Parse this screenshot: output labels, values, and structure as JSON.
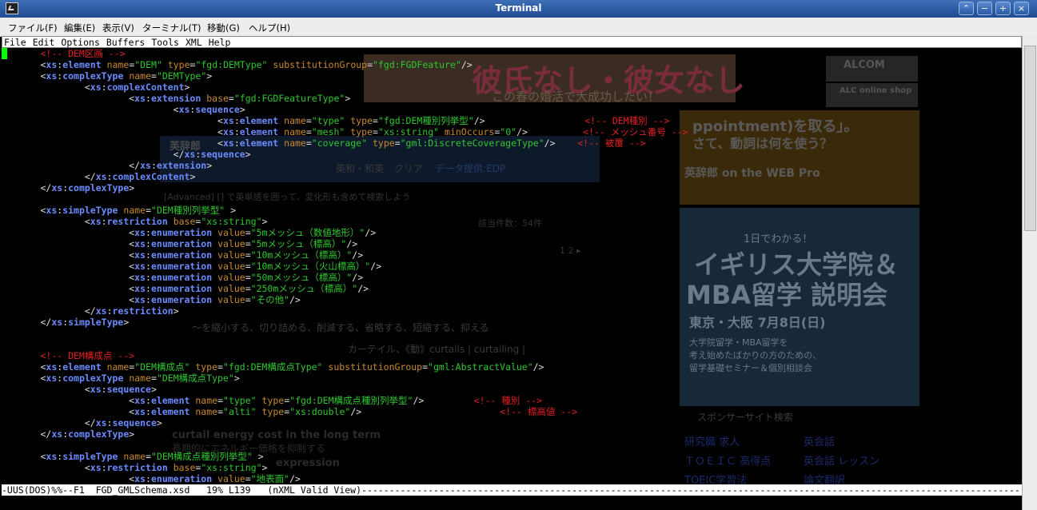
{
  "window": {
    "title": "Terminal",
    "buttons": [
      "⌃",
      "−",
      "+",
      "×"
    ]
  },
  "terminal_menu": [
    "ファイル(F)",
    "編集(E)",
    "表示(V)",
    "ターミナル(T)",
    "移動(G)",
    "ヘルプ(H)"
  ],
  "emacs_menu": [
    "File",
    "Edit",
    "Options",
    "Buffers",
    "Tools",
    "XML",
    "Help"
  ],
  "editor_lines": [
    [
      [
        "cmt",
        "<!-- DEM区画 -->"
      ]
    ],
    [
      [
        "p",
        "<"
      ],
      [
        "ns",
        "xs"
      ],
      [
        "p",
        ":"
      ],
      [
        "tag",
        "element"
      ],
      [
        "p",
        " "
      ],
      [
        "attr",
        "name"
      ],
      [
        "p",
        "="
      ],
      [
        "val",
        "\"DEM\""
      ],
      [
        "p",
        " "
      ],
      [
        "attr",
        "type"
      ],
      [
        "p",
        "="
      ],
      [
        "val",
        "\"fgd:DEMType\""
      ],
      [
        "p",
        " "
      ],
      [
        "attr",
        "substitutionGroup"
      ],
      [
        "p",
        "="
      ],
      [
        "val",
        "\"fgd:FGDFeature\""
      ],
      [
        "p",
        "/>"
      ]
    ],
    [
      [
        "p",
        "<"
      ],
      [
        "ns",
        "xs"
      ],
      [
        "p",
        ":"
      ],
      [
        "tag",
        "complexType"
      ],
      [
        "p",
        " "
      ],
      [
        "attr",
        "name"
      ],
      [
        "p",
        "="
      ],
      [
        "val",
        "\"DEMType\""
      ],
      [
        "p",
        ">"
      ]
    ],
    [
      [
        "p",
        "        <"
      ],
      [
        "ns",
        "xs"
      ],
      [
        "p",
        ":"
      ],
      [
        "tag",
        "complexContent"
      ],
      [
        "p",
        ">"
      ]
    ],
    [
      [
        "p",
        "                <"
      ],
      [
        "ns",
        "xs"
      ],
      [
        "p",
        ":"
      ],
      [
        "tag",
        "extension"
      ],
      [
        "p",
        " "
      ],
      [
        "attr",
        "base"
      ],
      [
        "p",
        "="
      ],
      [
        "val",
        "\"fgd:FGDFeatureType\""
      ],
      [
        "p",
        ">"
      ]
    ],
    [
      [
        "p",
        "                        <"
      ],
      [
        "ns",
        "xs"
      ],
      [
        "p",
        ":"
      ],
      [
        "tag",
        "sequence"
      ],
      [
        "p",
        ">"
      ]
    ],
    [
      [
        "p",
        "                                <"
      ],
      [
        "ns",
        "xs"
      ],
      [
        "p",
        ":"
      ],
      [
        "tag",
        "element"
      ],
      [
        "p",
        " "
      ],
      [
        "attr",
        "name"
      ],
      [
        "p",
        "="
      ],
      [
        "val",
        "\"type\""
      ],
      [
        "p",
        " "
      ],
      [
        "attr",
        "type"
      ],
      [
        "p",
        "="
      ],
      [
        "val",
        "\"fgd:DEM種別列挙型\""
      ],
      [
        "p",
        "/>                  "
      ],
      [
        "cmt",
        "<!-- DEM種別 -->"
      ]
    ],
    [
      [
        "p",
        "                                <"
      ],
      [
        "ns",
        "xs"
      ],
      [
        "p",
        ":"
      ],
      [
        "tag",
        "element"
      ],
      [
        "p",
        " "
      ],
      [
        "attr",
        "name"
      ],
      [
        "p",
        "="
      ],
      [
        "val",
        "\"mesh\""
      ],
      [
        "p",
        " "
      ],
      [
        "attr",
        "type"
      ],
      [
        "p",
        "="
      ],
      [
        "val",
        "\"xs:string\""
      ],
      [
        "p",
        " "
      ],
      [
        "attr",
        "minOccurs"
      ],
      [
        "p",
        "="
      ],
      [
        "val",
        "\"0\""
      ],
      [
        "p",
        "/>          "
      ],
      [
        "cmt",
        "<!-- メッシュ番号 -->"
      ]
    ],
    [
      [
        "p",
        "                                <"
      ],
      [
        "ns",
        "xs"
      ],
      [
        "p",
        ":"
      ],
      [
        "tag",
        "element"
      ],
      [
        "p",
        " "
      ],
      [
        "attr",
        "name"
      ],
      [
        "p",
        "="
      ],
      [
        "val",
        "\"coverage\""
      ],
      [
        "p",
        " "
      ],
      [
        "attr",
        "type"
      ],
      [
        "p",
        "="
      ],
      [
        "val",
        "\"gml:DiscreteCoverageType\""
      ],
      [
        "p",
        "/>    "
      ],
      [
        "cmt",
        "<!-- 被覆 -->"
      ]
    ],
    [
      [
        "p",
        "                        </"
      ],
      [
        "ns",
        "xs"
      ],
      [
        "p",
        ":"
      ],
      [
        "tag",
        "sequence"
      ],
      [
        "p",
        ">"
      ]
    ],
    [
      [
        "p",
        "                </"
      ],
      [
        "ns",
        "xs"
      ],
      [
        "p",
        ":"
      ],
      [
        "tag",
        "extension"
      ],
      [
        "p",
        ">"
      ]
    ],
    [
      [
        "p",
        "        </"
      ],
      [
        "ns",
        "xs"
      ],
      [
        "p",
        ":"
      ],
      [
        "tag",
        "complexContent"
      ],
      [
        "p",
        ">"
      ]
    ],
    [
      [
        "p",
        "</"
      ],
      [
        "ns",
        "xs"
      ],
      [
        "p",
        ":"
      ],
      [
        "tag",
        "complexType"
      ],
      [
        "p",
        ">"
      ]
    ],
    [
      [
        "p",
        ""
      ]
    ],
    [
      [
        "p",
        "<"
      ],
      [
        "ns",
        "xs"
      ],
      [
        "p",
        ":"
      ],
      [
        "tag",
        "simpleType"
      ],
      [
        "p",
        " "
      ],
      [
        "attr",
        "name"
      ],
      [
        "p",
        "="
      ],
      [
        "val",
        "\"DEM種別列挙型\""
      ],
      [
        "p",
        " >"
      ]
    ],
    [
      [
        "p",
        "        <"
      ],
      [
        "ns",
        "xs"
      ],
      [
        "p",
        ":"
      ],
      [
        "tag",
        "restriction"
      ],
      [
        "p",
        " "
      ],
      [
        "attr",
        "base"
      ],
      [
        "p",
        "="
      ],
      [
        "val",
        "\"xs:string\""
      ],
      [
        "p",
        ">"
      ]
    ],
    [
      [
        "p",
        "                <"
      ],
      [
        "ns",
        "xs"
      ],
      [
        "p",
        ":"
      ],
      [
        "tag",
        "enumeration"
      ],
      [
        "p",
        " "
      ],
      [
        "attr",
        "value"
      ],
      [
        "p",
        "="
      ],
      [
        "val",
        "\"5mメッシュ（数値地形）\""
      ],
      [
        "p",
        "/>"
      ]
    ],
    [
      [
        "p",
        "                <"
      ],
      [
        "ns",
        "xs"
      ],
      [
        "p",
        ":"
      ],
      [
        "tag",
        "enumeration"
      ],
      [
        "p",
        " "
      ],
      [
        "attr",
        "value"
      ],
      [
        "p",
        "="
      ],
      [
        "val",
        "\"5mメッシュ（標高）\""
      ],
      [
        "p",
        "/>"
      ]
    ],
    [
      [
        "p",
        "                <"
      ],
      [
        "ns",
        "xs"
      ],
      [
        "p",
        ":"
      ],
      [
        "tag",
        "enumeration"
      ],
      [
        "p",
        " "
      ],
      [
        "attr",
        "value"
      ],
      [
        "p",
        "="
      ],
      [
        "val",
        "\"10mメッシュ（標高）\""
      ],
      [
        "p",
        "/>"
      ]
    ],
    [
      [
        "p",
        "                <"
      ],
      [
        "ns",
        "xs"
      ],
      [
        "p",
        ":"
      ],
      [
        "tag",
        "enumeration"
      ],
      [
        "p",
        " "
      ],
      [
        "attr",
        "value"
      ],
      [
        "p",
        "="
      ],
      [
        "val",
        "\"10mメッシュ（火山標高）\""
      ],
      [
        "p",
        "/>"
      ]
    ],
    [
      [
        "p",
        "                <"
      ],
      [
        "ns",
        "xs"
      ],
      [
        "p",
        ":"
      ],
      [
        "tag",
        "enumeration"
      ],
      [
        "p",
        " "
      ],
      [
        "attr",
        "value"
      ],
      [
        "p",
        "="
      ],
      [
        "val",
        "\"50mメッシュ（標高）\""
      ],
      [
        "p",
        "/>"
      ]
    ],
    [
      [
        "p",
        "                <"
      ],
      [
        "ns",
        "xs"
      ],
      [
        "p",
        ":"
      ],
      [
        "tag",
        "enumeration"
      ],
      [
        "p",
        " "
      ],
      [
        "attr",
        "value"
      ],
      [
        "p",
        "="
      ],
      [
        "val",
        "\"250mメッシュ（標高）\""
      ],
      [
        "p",
        "/>"
      ]
    ],
    [
      [
        "p",
        "                <"
      ],
      [
        "ns",
        "xs"
      ],
      [
        "p",
        ":"
      ],
      [
        "tag",
        "enumeration"
      ],
      [
        "p",
        " "
      ],
      [
        "attr",
        "value"
      ],
      [
        "p",
        "="
      ],
      [
        "val",
        "\"その他\""
      ],
      [
        "p",
        "/>"
      ]
    ],
    [
      [
        "p",
        "        </"
      ],
      [
        "ns",
        "xs"
      ],
      [
        "p",
        ":"
      ],
      [
        "tag",
        "restriction"
      ],
      [
        "p",
        ">"
      ]
    ],
    [
      [
        "p",
        "</"
      ],
      [
        "ns",
        "xs"
      ],
      [
        "p",
        ":"
      ],
      [
        "tag",
        "simpleType"
      ],
      [
        "p",
        ">"
      ]
    ],
    [
      [
        "p",
        ""
      ]
    ],
    [
      [
        "p",
        ""
      ]
    ],
    [
      [
        "cmt",
        "<!-- DEM構成点 -->"
      ]
    ],
    [
      [
        "p",
        "<"
      ],
      [
        "ns",
        "xs"
      ],
      [
        "p",
        ":"
      ],
      [
        "tag",
        "element"
      ],
      [
        "p",
        " "
      ],
      [
        "attr",
        "name"
      ],
      [
        "p",
        "="
      ],
      [
        "val",
        "\"DEM構成点\""
      ],
      [
        "p",
        " "
      ],
      [
        "attr",
        "type"
      ],
      [
        "p",
        "="
      ],
      [
        "val",
        "\"fgd:DEM構成点Type\""
      ],
      [
        "p",
        " "
      ],
      [
        "attr",
        "substitutionGroup"
      ],
      [
        "p",
        "="
      ],
      [
        "val",
        "\"gml:AbstractValue\""
      ],
      [
        "p",
        "/>"
      ]
    ],
    [
      [
        "p",
        "<"
      ],
      [
        "ns",
        "xs"
      ],
      [
        "p",
        ":"
      ],
      [
        "tag",
        "complexType"
      ],
      [
        "p",
        " "
      ],
      [
        "attr",
        "name"
      ],
      [
        "p",
        "="
      ],
      [
        "val",
        "\"DEM構成点Type\""
      ],
      [
        "p",
        ">"
      ]
    ],
    [
      [
        "p",
        "        <"
      ],
      [
        "ns",
        "xs"
      ],
      [
        "p",
        ":"
      ],
      [
        "tag",
        "sequence"
      ],
      [
        "p",
        ">"
      ]
    ],
    [
      [
        "p",
        "                <"
      ],
      [
        "ns",
        "xs"
      ],
      [
        "p",
        ":"
      ],
      [
        "tag",
        "element"
      ],
      [
        "p",
        " "
      ],
      [
        "attr",
        "name"
      ],
      [
        "p",
        "="
      ],
      [
        "val",
        "\"type\""
      ],
      [
        "p",
        " "
      ],
      [
        "attr",
        "type"
      ],
      [
        "p",
        "="
      ],
      [
        "val",
        "\"fgd:DEM構成点種別列挙型\""
      ],
      [
        "p",
        "/>         "
      ],
      [
        "cmt",
        "<!-- 種別 -->"
      ]
    ],
    [
      [
        "p",
        "                <"
      ],
      [
        "ns",
        "xs"
      ],
      [
        "p",
        ":"
      ],
      [
        "tag",
        "element"
      ],
      [
        "p",
        " "
      ],
      [
        "attr",
        "name"
      ],
      [
        "p",
        "="
      ],
      [
        "val",
        "\"alti\""
      ],
      [
        "p",
        " "
      ],
      [
        "attr",
        "type"
      ],
      [
        "p",
        "="
      ],
      [
        "val",
        "\"xs:double\""
      ],
      [
        "p",
        "/>                         "
      ],
      [
        "cmt",
        "<!-- 標高値 -->"
      ]
    ],
    [
      [
        "p",
        "        </"
      ],
      [
        "ns",
        "xs"
      ],
      [
        "p",
        ":"
      ],
      [
        "tag",
        "sequence"
      ],
      [
        "p",
        ">"
      ]
    ],
    [
      [
        "p",
        "</"
      ],
      [
        "ns",
        "xs"
      ],
      [
        "p",
        ":"
      ],
      [
        "tag",
        "complexType"
      ],
      [
        "p",
        ">"
      ]
    ],
    [
      [
        "p",
        ""
      ]
    ],
    [
      [
        "p",
        "<"
      ],
      [
        "ns",
        "xs"
      ],
      [
        "p",
        ":"
      ],
      [
        "tag",
        "simpleType"
      ],
      [
        "p",
        " "
      ],
      [
        "attr",
        "name"
      ],
      [
        "p",
        "="
      ],
      [
        "val",
        "\"DEM構成点種別列挙型\""
      ],
      [
        "p",
        " >"
      ]
    ],
    [
      [
        "p",
        "        <"
      ],
      [
        "ns",
        "xs"
      ],
      [
        "p",
        ":"
      ],
      [
        "tag",
        "restriction"
      ],
      [
        "p",
        " "
      ],
      [
        "attr",
        "base"
      ],
      [
        "p",
        "="
      ],
      [
        "val",
        "\"xs:string\""
      ],
      [
        "p",
        ">"
      ]
    ],
    [
      [
        "p",
        "                <"
      ],
      [
        "ns",
        "xs"
      ],
      [
        "p",
        ":"
      ],
      [
        "tag",
        "enumeration"
      ],
      [
        "p",
        " "
      ],
      [
        "attr",
        "value"
      ],
      [
        "p",
        "="
      ],
      [
        "val",
        "\"地表面\""
      ],
      [
        "p",
        "/>"
      ]
    ]
  ],
  "modeline": "-UUS(DOS)%%--F1  FGD_GMLSchema.xsd   19% L139   (nXML Valid View)---------------------------------------------------------------------------------------------------------------------------",
  "ghost_text": [
    "彼氏なし・彼女なし",
    "この春の婚活で大成功したい！",
    "ALCOM",
    "ALC online shop",
    "英辞郎",
    "英和・和英",
    "クリア",
    "データ提供:EDP",
    "[Advanced] [] で英単語を囲って、変化形も含めて検索しよう",
    "該当件数：54件",
    "1 2 ▸",
    "～を縮小する、切り詰める、削減する、省略する、短縮する、抑える",
    "カーテイル、《動》curtails | curtailing |",
    "curtail energy cost in the long term",
    "長期的にエネルギー価格を抑制する",
    "expression",
    "ppointment)を取る」。",
    "さて、動詞は何を使う？",
    "英辞郎 on the WEB Pro",
    "1日でわかる！",
    "イギリス大学院＆",
    "MBA留学 説明会",
    "東京・大阪 7月8日(日)",
    "大学院留学・MBA留学を",
    "考え始めたばかりの方のための、",
    "留学基礎セミナー＆個別相談会",
    "スポンサーサイト検索",
    "研究職 求人",
    "英会話",
    "ＴＯＥＩＣ 高得点",
    "英会話 レッスン",
    "TOEIC学習法",
    "論文翻訳"
  ]
}
